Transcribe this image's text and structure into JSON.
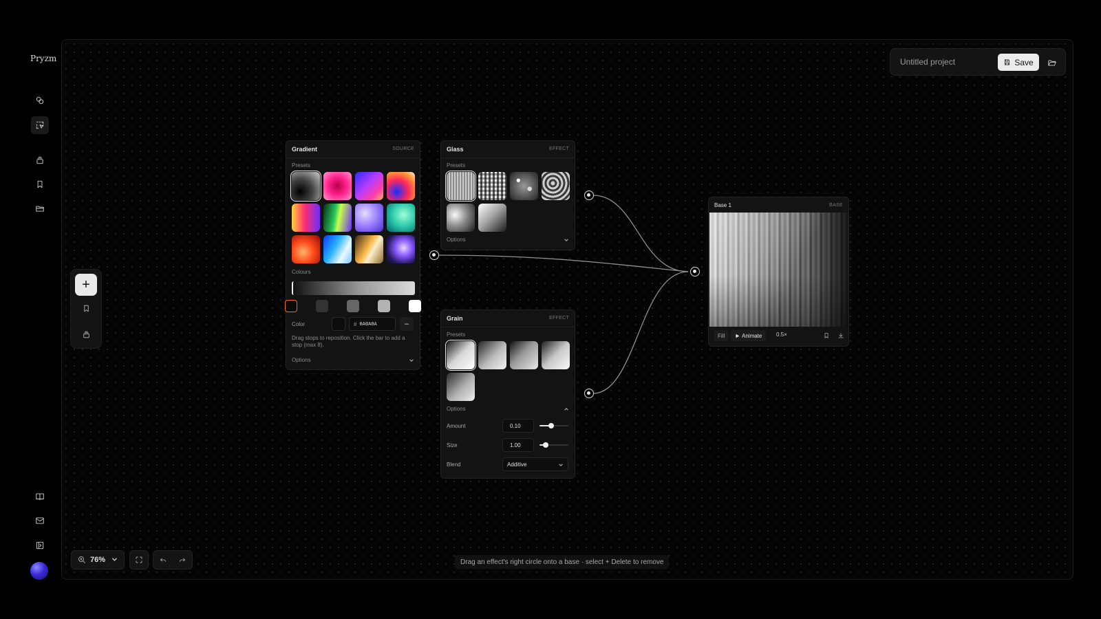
{
  "app": {
    "brand": "Pryzm"
  },
  "sidebar": {
    "top_icons": [
      "link-icon",
      "select-icon"
    ],
    "mid_icons": [
      "layers-icon",
      "bookmark-icon",
      "folder-icon"
    ],
    "bottom_icons": [
      "book-icon",
      "mail-icon",
      "panel-icon"
    ]
  },
  "project": {
    "name": "Untitled project",
    "save_label": "Save"
  },
  "float_toolbar": {
    "add_label": "+"
  },
  "nodes": {
    "gradient": {
      "title": "Gradient",
      "type": "SOURCE",
      "presets_label": "Presets",
      "colours_label": "Colours",
      "color_label": "Color",
      "hash": "#",
      "hex_value": "0A0A0A",
      "remove_label": "–",
      "help": "Drag stops to reposition. Click the bar to add a stop (max 8).",
      "options_label": "Options",
      "presets": [
        "radial-gradient(circle at 30% 70%, #000 0%, #444 45%, #cfcfcf 100%)",
        "radial-gradient(circle, #b4004a 0%, #ff1f8a 45%, #ff9bd0 100%)",
        "linear-gradient(135deg, #2a2aff 0%, #b63cff 45%, #ff3fa6 75%, #ffb36b 100%)",
        "radial-gradient(circle at 35% 70%, #1e2cff 0%, #ff2a5a 45%, #ff9a3a 75%, #fff0e0 100%)",
        "linear-gradient(90deg, #ffd23a 0%, #ff2f6e 45%, #6a2cff 100%)",
        "linear-gradient(100deg, #0a2a18 0%, #28c85a 40%, #c8ff4a 55%, #6a2cff 100%)",
        "radial-gradient(circle at 35% 35%, #e6dcff 0%, #9a7cff 50%, #4a30c8 100%)",
        "radial-gradient(circle at 60% 40%, #9cffd8 0%, #2ac8a8 50%, #0a5a6a 100%)",
        "radial-gradient(circle at 40% 60%, #ffb36b 0%, #ff4a1a 45%, #8a0a0a 100%)",
        "linear-gradient(120deg, #0a3aff 0%, #27b0ff 40%, #e8fbff 70%, #7cc8ff 100%)",
        "linear-gradient(120deg, #3a2a1a 0%, #ffb84a 45%, #fff0c8 60%, #8a6a2a 100%)",
        "radial-gradient(circle at 60% 45%, #e8d8ff 0%, #8a5aff 35%, #2a1a6a 70%, #0a0a1a 100%)"
      ],
      "stops": [
        "#0a0a0a",
        "#333333",
        "#666666",
        "#b3b3b3",
        "#ffffff"
      ]
    },
    "glass": {
      "title": "Glass",
      "type": "EFFECT",
      "presets_label": "Presets",
      "options_label": "Options",
      "presets": [
        "repeating-linear-gradient(90deg, #f0f0f0 0px, #6a6a6a 2px, #e8e8e8 4px), linear-gradient(90deg, #fff, #333)",
        "repeating-linear-gradient(0deg, rgba(0,0,0,0.35) 0 3px, transparent 3px 6px), repeating-linear-gradient(90deg, #eaeaea 0 3px, #555 3px 6px)",
        "radial-gradient(circle at 30% 30%, #fff 0 6%, transparent 7%), radial-gradient(circle at 70% 60%, #ddd 0 8%, transparent 9%), radial-gradient(circle at 50% 50%, #999 0%, #222 100%)",
        "repeating-radial-gradient(circle at 40% 40%, #cfcfcf 0 3px, #3a3a3a 3px 6px)",
        "radial-gradient(circle at 30% 40%, #fafafa 0%, #8a8a8a 45%, #1a1a1a 100%)",
        "linear-gradient(135deg, #fff 0%, #a8a8a8 45%, #1a1a1a 100%)"
      ]
    },
    "grain": {
      "title": "Grain",
      "type": "EFFECT",
      "presets_label": "Presets",
      "options_label": "Options",
      "presets": [
        "linear-gradient(135deg, #1a1a1a 0%, #d8d8d8 50%, #fff 100%)",
        "linear-gradient(135deg, #262626 0%, #bdbdbd 55%, #f2f2f2 100%)",
        "linear-gradient(135deg, #111 0%, #9a9a9a 45%, #e8e8e8 100%)",
        "linear-gradient(135deg, #1e1e1e 0%, #c8c8c8 50%, #fafafa 100%)",
        "linear-gradient(135deg, #2a2a2a 0%, #b0b0b0 55%, #efefef 100%)"
      ],
      "params": [
        {
          "label": "Amount",
          "value": "0.10",
          "fraction": 0.4
        },
        {
          "label": "Size",
          "value": "1.00",
          "fraction": 0.22
        }
      ],
      "blend_label": "Blend",
      "blend_value": "Additive"
    },
    "base": {
      "title": "Base 1",
      "type": "BASE",
      "fill_label": "Fill",
      "animate_label": "Animate",
      "speed_label": "0.5×"
    }
  },
  "footer": {
    "zoom_value": "76%",
    "hint": "Drag an effect's right circle onto a base · select + Delete to remove"
  },
  "colors": {
    "accent_stop": "#ff6a1a",
    "background": "#000000",
    "panel": "#131313"
  }
}
